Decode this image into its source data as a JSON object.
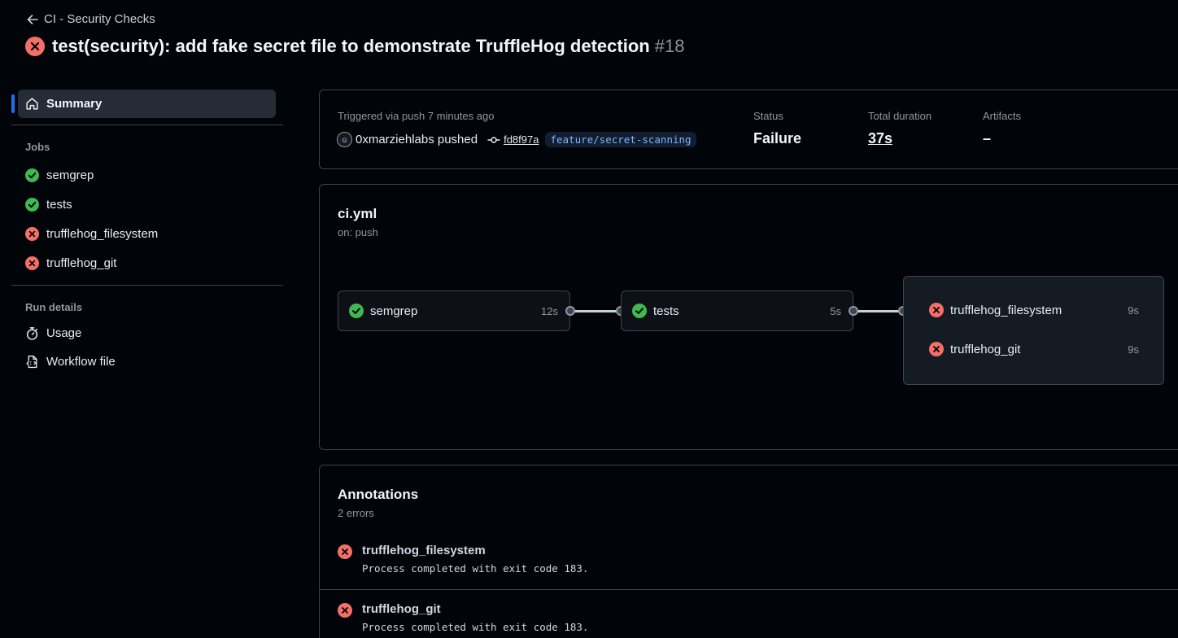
{
  "header": {
    "back_label": "CI - Security Checks",
    "title": "test(security): add fake secret file to demonstrate TruffleHog detection",
    "run_number": "#18"
  },
  "sidebar": {
    "summary_label": "Summary",
    "jobs_heading": "Jobs",
    "jobs": [
      {
        "name": "semgrep",
        "status": "success"
      },
      {
        "name": "tests",
        "status": "success"
      },
      {
        "name": "trufflehog_filesystem",
        "status": "failure"
      },
      {
        "name": "trufflehog_git",
        "status": "failure"
      }
    ],
    "run_details_heading": "Run details",
    "usage_label": "Usage",
    "workflow_file_label": "Workflow file"
  },
  "summary_card": {
    "triggered_text": "Triggered via push 7 minutes ago",
    "actor_text": "0xmarziehlabs pushed",
    "commit_sha": "fd8f97a",
    "branch": "feature/secret-scanning",
    "status_label": "Status",
    "status_value": "Failure",
    "duration_label": "Total duration",
    "duration_value": "37s",
    "artifacts_label": "Artifacts",
    "artifacts_value": "–"
  },
  "workflow": {
    "file_name": "ci.yml",
    "trigger": "on: push",
    "jobs": {
      "semgrep": {
        "name": "semgrep",
        "duration": "12s"
      },
      "tests": {
        "name": "tests",
        "duration": "5s"
      },
      "trufflehog_filesystem": {
        "name": "trufflehog_filesystem",
        "duration": "9s"
      },
      "trufflehog_git": {
        "name": "trufflehog_git",
        "duration": "9s"
      }
    }
  },
  "annotations": {
    "title": "Annotations",
    "count_text": "2 errors",
    "items": [
      {
        "job": "trufflehog_filesystem",
        "message": "Process completed with exit code 183."
      },
      {
        "job": "trufflehog_git",
        "message": "Process completed with exit code 183."
      }
    ]
  },
  "colors": {
    "success": "#3fb950",
    "failure": "#f47067",
    "accent": "#1f6feb",
    "branch_text": "#7ab7ff"
  }
}
